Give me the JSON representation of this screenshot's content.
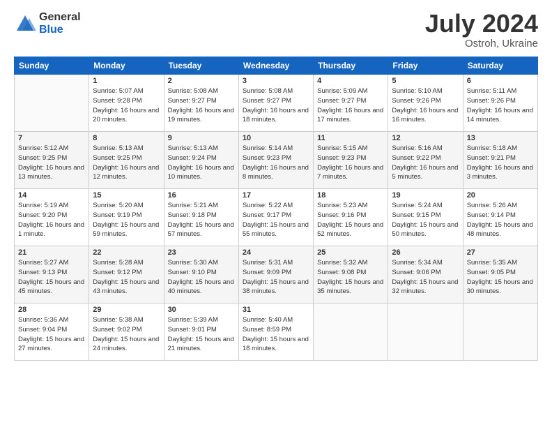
{
  "logo": {
    "general": "General",
    "blue": "Blue"
  },
  "title": {
    "month_year": "July 2024",
    "location": "Ostroh, Ukraine"
  },
  "headers": [
    "Sunday",
    "Monday",
    "Tuesday",
    "Wednesday",
    "Thursday",
    "Friday",
    "Saturday"
  ],
  "weeks": [
    [
      {
        "day": "",
        "sunrise": "",
        "sunset": "",
        "daylight": ""
      },
      {
        "day": "1",
        "sunrise": "Sunrise: 5:07 AM",
        "sunset": "Sunset: 9:28 PM",
        "daylight": "Daylight: 16 hours and 20 minutes."
      },
      {
        "day": "2",
        "sunrise": "Sunrise: 5:08 AM",
        "sunset": "Sunset: 9:27 PM",
        "daylight": "Daylight: 16 hours and 19 minutes."
      },
      {
        "day": "3",
        "sunrise": "Sunrise: 5:08 AM",
        "sunset": "Sunset: 9:27 PM",
        "daylight": "Daylight: 16 hours and 18 minutes."
      },
      {
        "day": "4",
        "sunrise": "Sunrise: 5:09 AM",
        "sunset": "Sunset: 9:27 PM",
        "daylight": "Daylight: 16 hours and 17 minutes."
      },
      {
        "day": "5",
        "sunrise": "Sunrise: 5:10 AM",
        "sunset": "Sunset: 9:26 PM",
        "daylight": "Daylight: 16 hours and 16 minutes."
      },
      {
        "day": "6",
        "sunrise": "Sunrise: 5:11 AM",
        "sunset": "Sunset: 9:26 PM",
        "daylight": "Daylight: 16 hours and 14 minutes."
      }
    ],
    [
      {
        "day": "7",
        "sunrise": "Sunrise: 5:12 AM",
        "sunset": "Sunset: 9:25 PM",
        "daylight": "Daylight: 16 hours and 13 minutes."
      },
      {
        "day": "8",
        "sunrise": "Sunrise: 5:13 AM",
        "sunset": "Sunset: 9:25 PM",
        "daylight": "Daylight: 16 hours and 12 minutes."
      },
      {
        "day": "9",
        "sunrise": "Sunrise: 5:13 AM",
        "sunset": "Sunset: 9:24 PM",
        "daylight": "Daylight: 16 hours and 10 minutes."
      },
      {
        "day": "10",
        "sunrise": "Sunrise: 5:14 AM",
        "sunset": "Sunset: 9:23 PM",
        "daylight": "Daylight: 16 hours and 8 minutes."
      },
      {
        "day": "11",
        "sunrise": "Sunrise: 5:15 AM",
        "sunset": "Sunset: 9:23 PM",
        "daylight": "Daylight: 16 hours and 7 minutes."
      },
      {
        "day": "12",
        "sunrise": "Sunrise: 5:16 AM",
        "sunset": "Sunset: 9:22 PM",
        "daylight": "Daylight: 16 hours and 5 minutes."
      },
      {
        "day": "13",
        "sunrise": "Sunrise: 5:18 AM",
        "sunset": "Sunset: 9:21 PM",
        "daylight": "Daylight: 16 hours and 3 minutes."
      }
    ],
    [
      {
        "day": "14",
        "sunrise": "Sunrise: 5:19 AM",
        "sunset": "Sunset: 9:20 PM",
        "daylight": "Daylight: 16 hours and 1 minute."
      },
      {
        "day": "15",
        "sunrise": "Sunrise: 5:20 AM",
        "sunset": "Sunset: 9:19 PM",
        "daylight": "Daylight: 15 hours and 59 minutes."
      },
      {
        "day": "16",
        "sunrise": "Sunrise: 5:21 AM",
        "sunset": "Sunset: 9:18 PM",
        "daylight": "Daylight: 15 hours and 57 minutes."
      },
      {
        "day": "17",
        "sunrise": "Sunrise: 5:22 AM",
        "sunset": "Sunset: 9:17 PM",
        "daylight": "Daylight: 15 hours and 55 minutes."
      },
      {
        "day": "18",
        "sunrise": "Sunrise: 5:23 AM",
        "sunset": "Sunset: 9:16 PM",
        "daylight": "Daylight: 15 hours and 52 minutes."
      },
      {
        "day": "19",
        "sunrise": "Sunrise: 5:24 AM",
        "sunset": "Sunset: 9:15 PM",
        "daylight": "Daylight: 15 hours and 50 minutes."
      },
      {
        "day": "20",
        "sunrise": "Sunrise: 5:26 AM",
        "sunset": "Sunset: 9:14 PM",
        "daylight": "Daylight: 15 hours and 48 minutes."
      }
    ],
    [
      {
        "day": "21",
        "sunrise": "Sunrise: 5:27 AM",
        "sunset": "Sunset: 9:13 PM",
        "daylight": "Daylight: 15 hours and 45 minutes."
      },
      {
        "day": "22",
        "sunrise": "Sunrise: 5:28 AM",
        "sunset": "Sunset: 9:12 PM",
        "daylight": "Daylight: 15 hours and 43 minutes."
      },
      {
        "day": "23",
        "sunrise": "Sunrise: 5:30 AM",
        "sunset": "Sunset: 9:10 PM",
        "daylight": "Daylight: 15 hours and 40 minutes."
      },
      {
        "day": "24",
        "sunrise": "Sunrise: 5:31 AM",
        "sunset": "Sunset: 9:09 PM",
        "daylight": "Daylight: 15 hours and 38 minutes."
      },
      {
        "day": "25",
        "sunrise": "Sunrise: 5:32 AM",
        "sunset": "Sunset: 9:08 PM",
        "daylight": "Daylight: 15 hours and 35 minutes."
      },
      {
        "day": "26",
        "sunrise": "Sunrise: 5:34 AM",
        "sunset": "Sunset: 9:06 PM",
        "daylight": "Daylight: 15 hours and 32 minutes."
      },
      {
        "day": "27",
        "sunrise": "Sunrise: 5:35 AM",
        "sunset": "Sunset: 9:05 PM",
        "daylight": "Daylight: 15 hours and 30 minutes."
      }
    ],
    [
      {
        "day": "28",
        "sunrise": "Sunrise: 5:36 AM",
        "sunset": "Sunset: 9:04 PM",
        "daylight": "Daylight: 15 hours and 27 minutes."
      },
      {
        "day": "29",
        "sunrise": "Sunrise: 5:38 AM",
        "sunset": "Sunset: 9:02 PM",
        "daylight": "Daylight: 15 hours and 24 minutes."
      },
      {
        "day": "30",
        "sunrise": "Sunrise: 5:39 AM",
        "sunset": "Sunset: 9:01 PM",
        "daylight": "Daylight: 15 hours and 21 minutes."
      },
      {
        "day": "31",
        "sunrise": "Sunrise: 5:40 AM",
        "sunset": "Sunset: 8:59 PM",
        "daylight": "Daylight: 15 hours and 18 minutes."
      },
      {
        "day": "",
        "sunrise": "",
        "sunset": "",
        "daylight": ""
      },
      {
        "day": "",
        "sunrise": "",
        "sunset": "",
        "daylight": ""
      },
      {
        "day": "",
        "sunrise": "",
        "sunset": "",
        "daylight": ""
      }
    ]
  ]
}
